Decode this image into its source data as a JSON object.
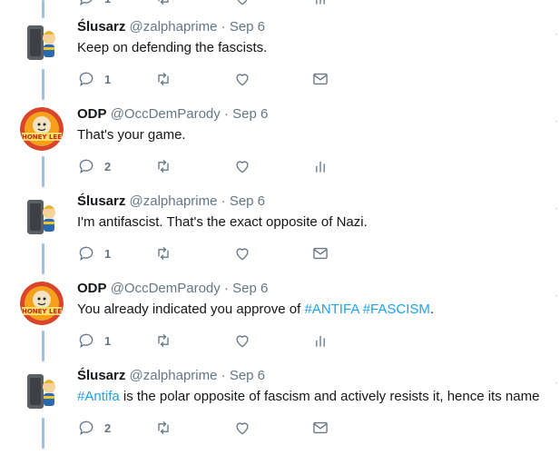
{
  "tweets": [
    {
      "name": "Ślusarz",
      "handle": "@zalphaprime",
      "date": "Sep 6",
      "avatar": "vault-boy-avatar",
      "text_parts": [
        {
          "t": "Keep on defending the fascists.",
          "tag": false
        }
      ],
      "reply_count": "1",
      "extra_icon": "envelope-icon"
    },
    {
      "name": "ODP",
      "handle": "@OccDemParody",
      "date": "Sep 6",
      "avatar": "honey-lee-avatar",
      "text_parts": [
        {
          "t": "That's your game.",
          "tag": false
        }
      ],
      "reply_count": "2",
      "extra_icon": "analytics-icon"
    },
    {
      "name": "Ślusarz",
      "handle": "@zalphaprime",
      "date": "Sep 6",
      "avatar": "vault-boy-avatar",
      "text_parts": [
        {
          "t": "I'm antifascist. That's the exact opposite of Nazi.",
          "tag": false
        }
      ],
      "reply_count": "1",
      "extra_icon": "envelope-icon"
    },
    {
      "name": "ODP",
      "handle": "@OccDemParody",
      "date": "Sep 6",
      "avatar": "honey-lee-avatar",
      "text_parts": [
        {
          "t": "You already indicated you approve of ",
          "tag": false
        },
        {
          "t": "#ANTIFA",
          "tag": true
        },
        {
          "t": " ",
          "tag": false
        },
        {
          "t": "#FASCISM",
          "tag": true
        },
        {
          "t": ".",
          "tag": false
        }
      ],
      "reply_count": "1",
      "extra_icon": "analytics-icon"
    },
    {
      "name": "Ślusarz",
      "handle": "@zalphaprime",
      "date": "Sep 6",
      "avatar": "vault-boy-avatar",
      "text_parts": [
        {
          "t": "#Antifa",
          "tag": true
        },
        {
          "t": " is the polar opposite of fascism and actively resists it, hence its name",
          "tag": false
        }
      ],
      "reply_count": "2",
      "extra_icon": "envelope-icon"
    }
  ],
  "top_partial": {
    "reply_count": "1"
  },
  "separator": "·",
  "colors": {
    "hashtag": "#1da1f2",
    "muted": "#657786",
    "thread_line": "#a0bfe0"
  }
}
